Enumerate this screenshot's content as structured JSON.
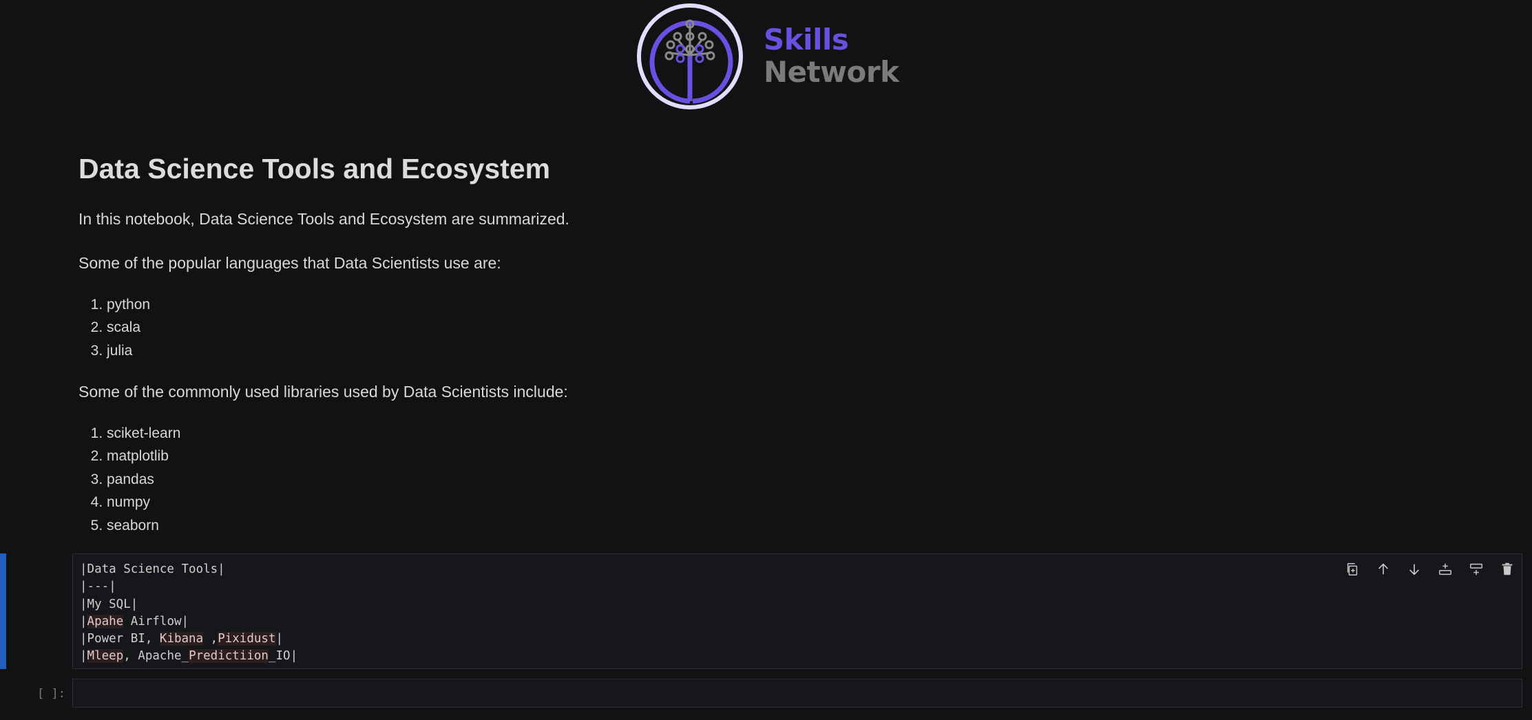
{
  "logo": {
    "word1": "Skills",
    "word2": "Network"
  },
  "title": "Data Science Tools and Ecosystem",
  "intro": "In this notebook, Data Science Tools and Ecosystem are summarized.",
  "languages_heading": "Some of the popular languages that Data Scientists use are:",
  "languages": [
    "python",
    "scala",
    "julia"
  ],
  "libraries_heading": "Some of the commonly used libraries used by Data Scientists include:",
  "libraries": [
    "sciket-learn",
    "matplotlib",
    "pandas",
    "numpy",
    "seaborn"
  ],
  "editing_cell": {
    "lines": [
      "|Data Science Tools|",
      "|---|",
      "|My SQL|",
      "|Apahe Airflow|",
      "|Power BI, Kibana ,Pixidust|",
      "|Mleep, Apache_Predictiion_IO|"
    ]
  },
  "empty_cell": {
    "prompt": "[ ]:"
  },
  "toolbar": [
    "duplicate-cell",
    "move-up",
    "move-down",
    "insert-below",
    "insert-above",
    "delete-cell"
  ],
  "colors": {
    "accent": "#1f5fbf",
    "logo_purple": "#6a4fe0",
    "background": "#111214"
  }
}
